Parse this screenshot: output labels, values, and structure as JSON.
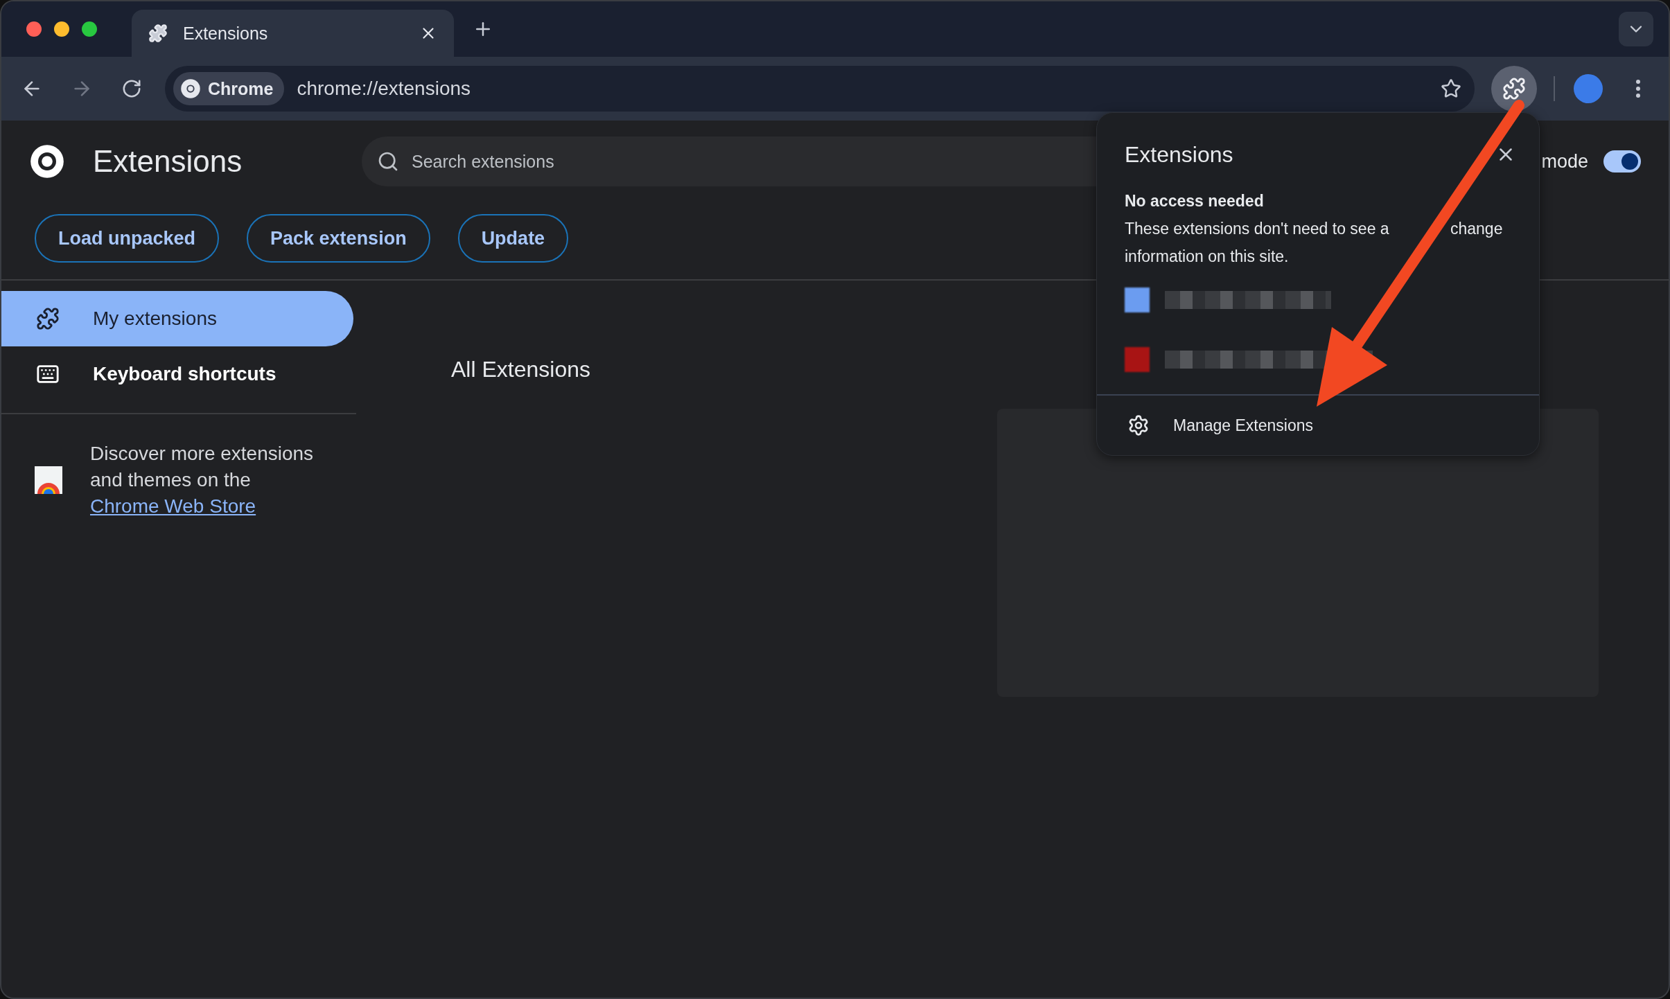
{
  "tabs": [
    {
      "title": "Extensions",
      "selected": true
    }
  ],
  "toolbar": {
    "forward_disabled": true,
    "site_chip": "Chrome",
    "url": "chrome://extensions",
    "extensions_button_active": true
  },
  "header": {
    "title": "Extensions",
    "search_placeholder": "Search extensions",
    "developer_mode_label": "mode",
    "developer_mode_on": true
  },
  "actions": [
    "Load unpacked",
    "Pack extension",
    "Update"
  ],
  "sidebar": {
    "items": [
      {
        "label": "My extensions",
        "kind": "extensions",
        "selected": true
      },
      {
        "label": "Keyboard shortcuts",
        "kind": "keyboard",
        "selected": false
      }
    ],
    "promo": {
      "text": "Discover more extensions and themes on the",
      "link": "Chrome Web Store"
    }
  },
  "main": {
    "section_title": "All Extensions"
  },
  "popup": {
    "title": "Extensions",
    "section_heading": "No access needed",
    "description_parts": [
      "These extensions don't need to see a",
      "change",
      "information on this site."
    ],
    "items": [
      {
        "color": "#6b9cf0"
      },
      {
        "color": "#a81414"
      }
    ],
    "footer": "Manage Extensions"
  }
}
